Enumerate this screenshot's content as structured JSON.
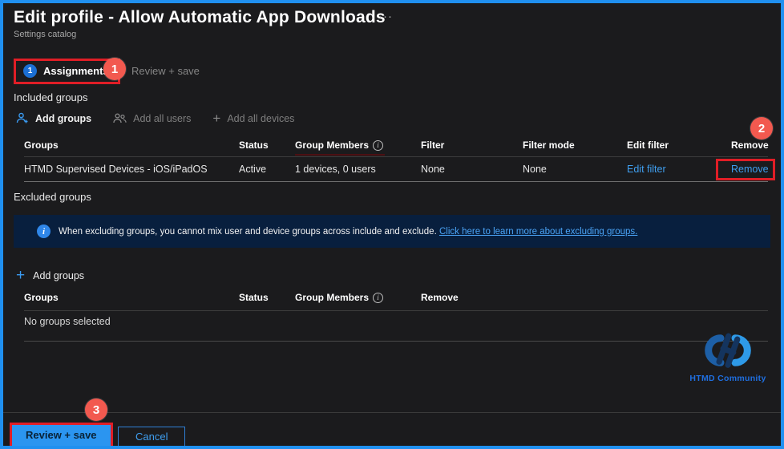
{
  "header": {
    "title": "Edit profile - Allow Automatic App Downloads",
    "ellipsis": "···",
    "subtitle": "Settings catalog"
  },
  "tabs": {
    "assignments": {
      "step": "1",
      "label": "Assignments"
    },
    "review": {
      "label": "Review + save"
    }
  },
  "annotations": {
    "badge1": "1",
    "badge2": "2",
    "badge3": "3"
  },
  "included": {
    "heading": "Included groups",
    "toolbar": {
      "add_groups": "Add groups",
      "add_all_users": "Add all users",
      "add_all_devices": "Add all devices"
    },
    "table": {
      "headers": [
        "Groups",
        "Status",
        "Group Members",
        "Filter",
        "Filter mode",
        "Edit filter",
        "Remove"
      ],
      "row": {
        "group": "HTMD Supervised Devices - iOS/iPadOS",
        "status": "Active",
        "members": "1 devices, 0 users",
        "filter": "None",
        "filter_mode": "None",
        "edit_filter": "Edit filter",
        "remove": "Remove"
      }
    }
  },
  "excluded": {
    "heading": "Excluded groups",
    "info": {
      "text": "When excluding groups, you cannot mix user and device groups across include and exclude.",
      "link": "Click here to learn more about excluding groups."
    },
    "add_groups": "Add groups",
    "table": {
      "headers": [
        "Groups",
        "Status",
        "Group Members",
        "Remove"
      ],
      "empty": "No groups selected"
    }
  },
  "glyphs": {
    "plus": "+",
    "info": "i"
  },
  "logo": {
    "text": "HTMD Community"
  },
  "footer": {
    "review_save": "Review + save",
    "cancel": "Cancel"
  },
  "colors": {
    "frame_border": "#2090f0",
    "background": "#1b1b1d",
    "annotation_red": "#e01e26",
    "badge_red": "#f2594f",
    "accent_blue": "#2b95f0",
    "link_blue": "#3f9ff0",
    "banner_bg": "#081f3e"
  }
}
